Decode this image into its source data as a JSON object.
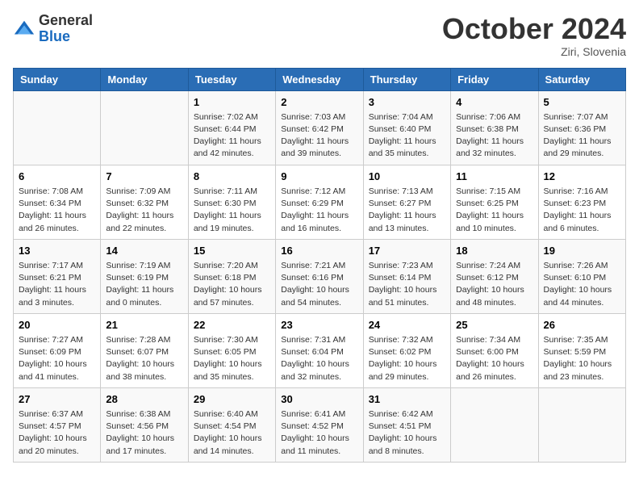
{
  "header": {
    "logo_general": "General",
    "logo_blue": "Blue",
    "month": "October 2024",
    "location": "Ziri, Slovenia"
  },
  "weekdays": [
    "Sunday",
    "Monday",
    "Tuesday",
    "Wednesday",
    "Thursday",
    "Friday",
    "Saturday"
  ],
  "weeks": [
    [
      {
        "day": "",
        "sunrise": "",
        "sunset": "",
        "daylight": ""
      },
      {
        "day": "",
        "sunrise": "",
        "sunset": "",
        "daylight": ""
      },
      {
        "day": "1",
        "sunrise": "Sunrise: 7:02 AM",
        "sunset": "Sunset: 6:44 PM",
        "daylight": "Daylight: 11 hours and 42 minutes."
      },
      {
        "day": "2",
        "sunrise": "Sunrise: 7:03 AM",
        "sunset": "Sunset: 6:42 PM",
        "daylight": "Daylight: 11 hours and 39 minutes."
      },
      {
        "day": "3",
        "sunrise": "Sunrise: 7:04 AM",
        "sunset": "Sunset: 6:40 PM",
        "daylight": "Daylight: 11 hours and 35 minutes."
      },
      {
        "day": "4",
        "sunrise": "Sunrise: 7:06 AM",
        "sunset": "Sunset: 6:38 PM",
        "daylight": "Daylight: 11 hours and 32 minutes."
      },
      {
        "day": "5",
        "sunrise": "Sunrise: 7:07 AM",
        "sunset": "Sunset: 6:36 PM",
        "daylight": "Daylight: 11 hours and 29 minutes."
      }
    ],
    [
      {
        "day": "6",
        "sunrise": "Sunrise: 7:08 AM",
        "sunset": "Sunset: 6:34 PM",
        "daylight": "Daylight: 11 hours and 26 minutes."
      },
      {
        "day": "7",
        "sunrise": "Sunrise: 7:09 AM",
        "sunset": "Sunset: 6:32 PM",
        "daylight": "Daylight: 11 hours and 22 minutes."
      },
      {
        "day": "8",
        "sunrise": "Sunrise: 7:11 AM",
        "sunset": "Sunset: 6:30 PM",
        "daylight": "Daylight: 11 hours and 19 minutes."
      },
      {
        "day": "9",
        "sunrise": "Sunrise: 7:12 AM",
        "sunset": "Sunset: 6:29 PM",
        "daylight": "Daylight: 11 hours and 16 minutes."
      },
      {
        "day": "10",
        "sunrise": "Sunrise: 7:13 AM",
        "sunset": "Sunset: 6:27 PM",
        "daylight": "Daylight: 11 hours and 13 minutes."
      },
      {
        "day": "11",
        "sunrise": "Sunrise: 7:15 AM",
        "sunset": "Sunset: 6:25 PM",
        "daylight": "Daylight: 11 hours and 10 minutes."
      },
      {
        "day": "12",
        "sunrise": "Sunrise: 7:16 AM",
        "sunset": "Sunset: 6:23 PM",
        "daylight": "Daylight: 11 hours and 6 minutes."
      }
    ],
    [
      {
        "day": "13",
        "sunrise": "Sunrise: 7:17 AM",
        "sunset": "Sunset: 6:21 PM",
        "daylight": "Daylight: 11 hours and 3 minutes."
      },
      {
        "day": "14",
        "sunrise": "Sunrise: 7:19 AM",
        "sunset": "Sunset: 6:19 PM",
        "daylight": "Daylight: 11 hours and 0 minutes."
      },
      {
        "day": "15",
        "sunrise": "Sunrise: 7:20 AM",
        "sunset": "Sunset: 6:18 PM",
        "daylight": "Daylight: 10 hours and 57 minutes."
      },
      {
        "day": "16",
        "sunrise": "Sunrise: 7:21 AM",
        "sunset": "Sunset: 6:16 PM",
        "daylight": "Daylight: 10 hours and 54 minutes."
      },
      {
        "day": "17",
        "sunrise": "Sunrise: 7:23 AM",
        "sunset": "Sunset: 6:14 PM",
        "daylight": "Daylight: 10 hours and 51 minutes."
      },
      {
        "day": "18",
        "sunrise": "Sunrise: 7:24 AM",
        "sunset": "Sunset: 6:12 PM",
        "daylight": "Daylight: 10 hours and 48 minutes."
      },
      {
        "day": "19",
        "sunrise": "Sunrise: 7:26 AM",
        "sunset": "Sunset: 6:10 PM",
        "daylight": "Daylight: 10 hours and 44 minutes."
      }
    ],
    [
      {
        "day": "20",
        "sunrise": "Sunrise: 7:27 AM",
        "sunset": "Sunset: 6:09 PM",
        "daylight": "Daylight: 10 hours and 41 minutes."
      },
      {
        "day": "21",
        "sunrise": "Sunrise: 7:28 AM",
        "sunset": "Sunset: 6:07 PM",
        "daylight": "Daylight: 10 hours and 38 minutes."
      },
      {
        "day": "22",
        "sunrise": "Sunrise: 7:30 AM",
        "sunset": "Sunset: 6:05 PM",
        "daylight": "Daylight: 10 hours and 35 minutes."
      },
      {
        "day": "23",
        "sunrise": "Sunrise: 7:31 AM",
        "sunset": "Sunset: 6:04 PM",
        "daylight": "Daylight: 10 hours and 32 minutes."
      },
      {
        "day": "24",
        "sunrise": "Sunrise: 7:32 AM",
        "sunset": "Sunset: 6:02 PM",
        "daylight": "Daylight: 10 hours and 29 minutes."
      },
      {
        "day": "25",
        "sunrise": "Sunrise: 7:34 AM",
        "sunset": "Sunset: 6:00 PM",
        "daylight": "Daylight: 10 hours and 26 minutes."
      },
      {
        "day": "26",
        "sunrise": "Sunrise: 7:35 AM",
        "sunset": "Sunset: 5:59 PM",
        "daylight": "Daylight: 10 hours and 23 minutes."
      }
    ],
    [
      {
        "day": "27",
        "sunrise": "Sunrise: 6:37 AM",
        "sunset": "Sunset: 4:57 PM",
        "daylight": "Daylight: 10 hours and 20 minutes."
      },
      {
        "day": "28",
        "sunrise": "Sunrise: 6:38 AM",
        "sunset": "Sunset: 4:56 PM",
        "daylight": "Daylight: 10 hours and 17 minutes."
      },
      {
        "day": "29",
        "sunrise": "Sunrise: 6:40 AM",
        "sunset": "Sunset: 4:54 PM",
        "daylight": "Daylight: 10 hours and 14 minutes."
      },
      {
        "day": "30",
        "sunrise": "Sunrise: 6:41 AM",
        "sunset": "Sunset: 4:52 PM",
        "daylight": "Daylight: 10 hours and 11 minutes."
      },
      {
        "day": "31",
        "sunrise": "Sunrise: 6:42 AM",
        "sunset": "Sunset: 4:51 PM",
        "daylight": "Daylight: 10 hours and 8 minutes."
      },
      {
        "day": "",
        "sunrise": "",
        "sunset": "",
        "daylight": ""
      },
      {
        "day": "",
        "sunrise": "",
        "sunset": "",
        "daylight": ""
      }
    ]
  ]
}
